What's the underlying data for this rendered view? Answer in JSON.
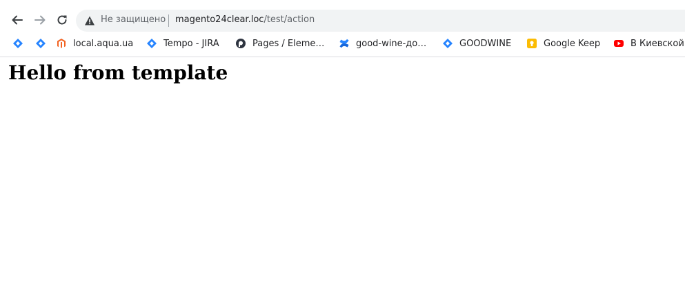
{
  "browser": {
    "security_status": "Не защищено",
    "url_host": "magento24clear.loc",
    "url_path": "/test/action"
  },
  "bookmarks": [
    {
      "label": "",
      "icon": "jira-diamond-icon"
    },
    {
      "label": "",
      "icon": "jira-diamond-icon"
    },
    {
      "label": "local.aqua.ua",
      "icon": "magento-icon"
    },
    {
      "label": "Tempo - JIRA",
      "icon": "jira-diamond-icon"
    },
    {
      "label": "Pages / Eleme…",
      "icon": "elementor-icon"
    },
    {
      "label": "good-wine-до…",
      "icon": "confluence-icon"
    },
    {
      "label": "GOODWINE",
      "icon": "jira-diamond-icon"
    },
    {
      "label": "Google Keep",
      "icon": "google-keep-icon"
    },
    {
      "label": "В Киевской",
      "icon": "youtube-icon"
    }
  ],
  "page": {
    "heading": "Hello from template"
  },
  "colors": {
    "jira_blue": "#2684ff",
    "magento_orange": "#f26322",
    "keep_yellow": "#fbbc04",
    "youtube_red": "#ff0000"
  }
}
